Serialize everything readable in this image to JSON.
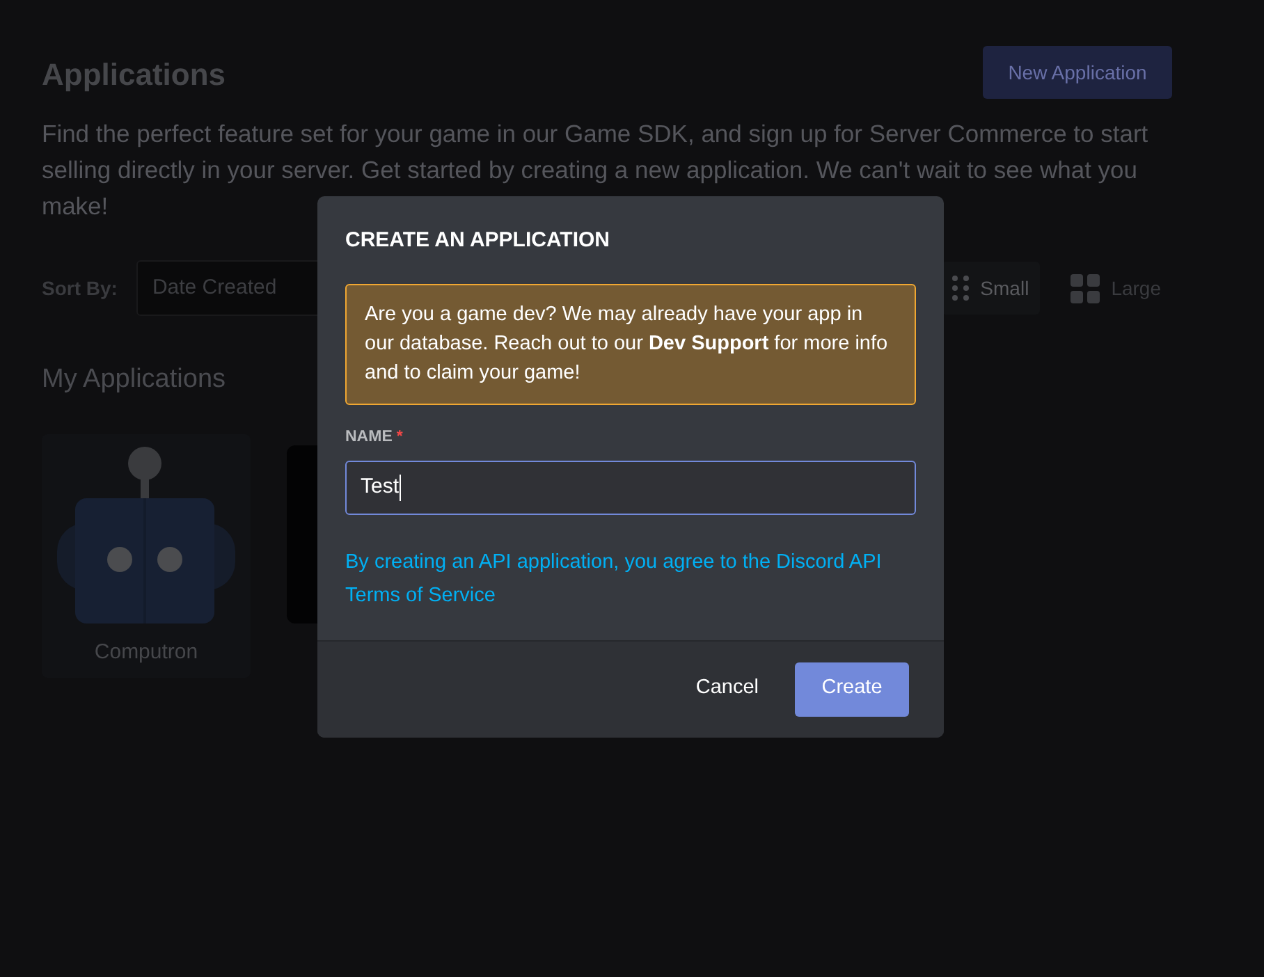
{
  "page": {
    "title": "Applications",
    "new_button": "New Application",
    "description": "Find the perfect feature set for your game in our Game SDK, and sign up for Server Commerce to start selling directly in your server. Get started by creating a new application. We can't wait to see what you make!",
    "sort_label": "Sort By:",
    "sort_value": "Date Created",
    "view_options": [
      {
        "label": "Small",
        "kind": "dots",
        "selected": true
      },
      {
        "label": "Large",
        "kind": "squares",
        "selected": false
      }
    ],
    "section_title": "My Applications",
    "apps": [
      {
        "name": "Computron",
        "kind": "robot"
      },
      {
        "kind": "partial"
      }
    ]
  },
  "modal": {
    "title": "CREATE AN APPLICATION",
    "notice": "Are you a game dev? We may already have your app in our database. Reach out to our **Dev Support** for more info and to claim your game!",
    "name_label": "NAME",
    "required_mark": "*",
    "name_value": "Test",
    "terms": "By creating an API application, you agree to the Discord API Terms of Service",
    "cancel": "Cancel",
    "create": "Create"
  }
}
